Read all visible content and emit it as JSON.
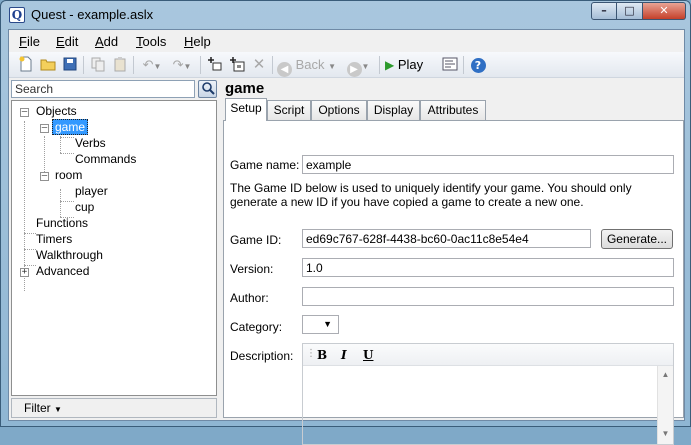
{
  "window": {
    "title": "Quest - example.aslx",
    "app_icon_glyph": "Q"
  },
  "menu": {
    "items": [
      {
        "first": "F",
        "rest": "ile"
      },
      {
        "first": "E",
        "rest": "dit"
      },
      {
        "first": "A",
        "rest": "dd"
      },
      {
        "first": "T",
        "rest": "ools"
      },
      {
        "first": "H",
        "rest": "elp"
      }
    ]
  },
  "toolbar": {
    "back_label": "Back",
    "play_label": "Play"
  },
  "sidebar": {
    "search_placeholder": "Search",
    "tree": {
      "objects": "Objects",
      "game": "game",
      "verbs": "Verbs",
      "commands": "Commands",
      "room": "room",
      "player": "player",
      "cup": "cup",
      "functions": "Functions",
      "timers": "Timers",
      "walkthrough": "Walkthrough",
      "advanced": "Advanced"
    },
    "filter_label": "Filter"
  },
  "editor": {
    "title": "game",
    "tabs": [
      "Setup",
      "Script",
      "Options",
      "Display",
      "Attributes"
    ],
    "active_tab": "Setup",
    "fields": {
      "game_name_label": "Game name:",
      "game_name_value": "example",
      "help_text": "The Game ID below is used to uniquely identify your game. You should only generate a new ID if you have copied a game to create a new one.",
      "game_id_label": "Game ID:",
      "game_id_value": "ed69c767-628f-4438-bc60-0ac11c8e54e4",
      "generate_label": "Generate...",
      "version_label": "Version:",
      "version_value": "1.0",
      "author_label": "Author:",
      "author_value": "",
      "category_label": "Category:",
      "category_value": "",
      "description_label": "Description:"
    },
    "format_buttons": [
      "B",
      "I",
      "U"
    ]
  }
}
